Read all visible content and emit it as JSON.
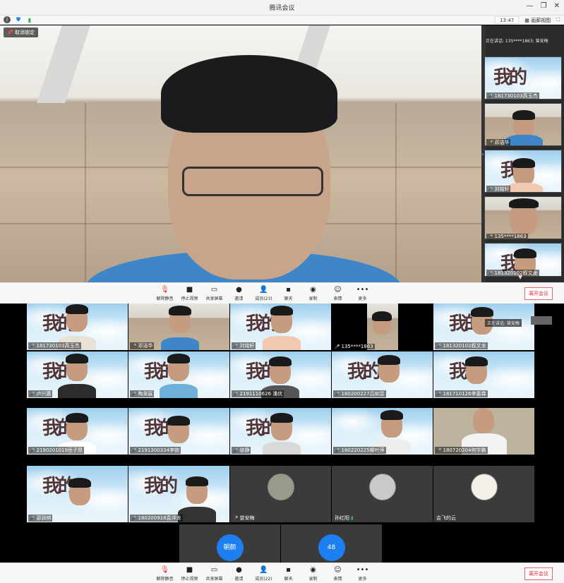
{
  "window": {
    "title": "腾讯会议"
  },
  "statusbar": {
    "time": "13:47",
    "view_label": "画廊视图"
  },
  "main": {
    "pin_label": "取消锁定"
  },
  "side": {
    "speaking": "正在讲话: 135****1863; 曾安梅",
    "thumbs": [
      {
        "name": "181730103高玉杰"
      },
      {
        "name": "邓洁华"
      },
      {
        "name": "刘铭轩"
      },
      {
        "name": "135****1863"
      },
      {
        "name": "181320102叙文龙"
      }
    ]
  },
  "toolbar": {
    "items": [
      {
        "label": "解除静音",
        "icon": "mic-muted-icon"
      },
      {
        "label": "停止视频",
        "icon": "camera-icon"
      },
      {
        "label": "共享屏幕",
        "icon": "screen-share-icon"
      },
      {
        "label": "邀请",
        "icon": "invite-icon"
      },
      {
        "label": "成员(23)",
        "icon": "members-icon"
      },
      {
        "label": "聊天",
        "icon": "chat-icon"
      },
      {
        "label": "录制",
        "icon": "record-icon"
      },
      {
        "label": "表情",
        "icon": "emoji-icon"
      },
      {
        "label": "更多",
        "icon": "more-icon"
      }
    ],
    "leave": "离开会议"
  },
  "toolbar2": {
    "items": [
      {
        "label": "解除静音"
      },
      {
        "label": "停止视频"
      },
      {
        "label": "共享屏幕"
      },
      {
        "label": "邀请"
      },
      {
        "label": "成员(22)"
      },
      {
        "label": "聊天"
      },
      {
        "label": "录制"
      },
      {
        "label": "表情"
      },
      {
        "label": "更多"
      }
    ],
    "leave": "离开会议"
  },
  "gallery": {
    "speaking_overlay": "正在讲话: 曾安梅",
    "tiles": [
      {
        "name": "181730103高玉杰"
      },
      {
        "name": "邓洁华"
      },
      {
        "name": "刘铭轩"
      },
      {
        "name": "135****1863"
      },
      {
        "name": "181320102叙文龙"
      },
      {
        "name": "卢兴惠"
      },
      {
        "name": "陶昊宸"
      },
      {
        "name": "2191110626 潘优"
      },
      {
        "name": "180200227吕如昱"
      },
      {
        "name": "181710126李嘉霖"
      },
      {
        "name": "2190201019岳子昂"
      },
      {
        "name": "2191300334李婉"
      },
      {
        "name": "徐静"
      },
      {
        "name": "180220225柳叶萍"
      },
      {
        "name": "180720204何宇鹏"
      },
      {
        "name": "邵润棋"
      },
      {
        "name": "180200918袁洋龙"
      },
      {
        "name": "曾安梅"
      },
      {
        "name": "孙红阳"
      },
      {
        "name": "会飞的云"
      }
    ],
    "bottom": [
      {
        "badge": "朝颜"
      },
      {
        "badge": "48"
      }
    ]
  }
}
